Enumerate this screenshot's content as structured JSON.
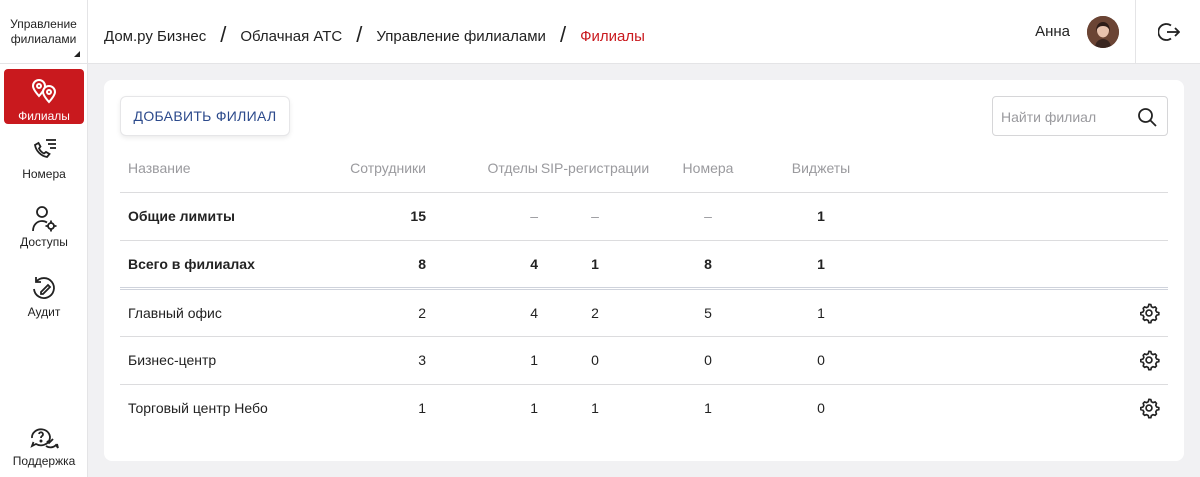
{
  "sidebar": {
    "section_switch": "Управление филиалами",
    "items": [
      {
        "label": "Филиалы",
        "icon": "branches-pin-icon",
        "active": true
      },
      {
        "label": "Номера",
        "icon": "phone-list-icon",
        "active": false
      },
      {
        "label": "Доступы",
        "icon": "user-gear-icon",
        "active": false
      },
      {
        "label": "Аудит",
        "icon": "audit-history-icon",
        "active": false
      }
    ],
    "support": {
      "label": "Поддержка",
      "icon": "support-chat-icon"
    }
  },
  "header": {
    "breadcrumbs": [
      "Дом.ру Бизнес",
      "Облачная АТС",
      "Управление филиалами",
      "Филиалы"
    ],
    "separator": "/",
    "user_name": "Анна",
    "logout_icon": "logout-icon"
  },
  "toolbar": {
    "add_label": "ДОБАВИТЬ ФИЛИАЛ",
    "search_placeholder": "Найти филиал",
    "search_value": ""
  },
  "table": {
    "columns": [
      "Название",
      "Сотрудники",
      "Отделы",
      "SIP-регистрации",
      "Номера",
      "Виджеты"
    ],
    "summary_rows": [
      {
        "name": "Общие лимиты",
        "employees": "15",
        "departments": "–",
        "sip": "–",
        "numbers": "–",
        "widgets": "1"
      },
      {
        "name": "Всего в филиалах",
        "employees": "8",
        "departments": "4",
        "sip": "1",
        "numbers": "8",
        "widgets": "1"
      }
    ],
    "rows": [
      {
        "name": "Главный офис",
        "employees": "2",
        "departments": "4",
        "sip": "2",
        "numbers": "5",
        "widgets": "1"
      },
      {
        "name": "Бизнес-центр",
        "employees": "3",
        "departments": "1",
        "sip": "0",
        "numbers": "0",
        "widgets": "0"
      },
      {
        "name": "Торговый центр Небо",
        "employees": "1",
        "departments": "1",
        "sip": "1",
        "numbers": "1",
        "widgets": "0"
      }
    ]
  },
  "colors": {
    "accent": "#c9191e",
    "link": "#2c4a8c",
    "muted": "#9a9a9e"
  }
}
